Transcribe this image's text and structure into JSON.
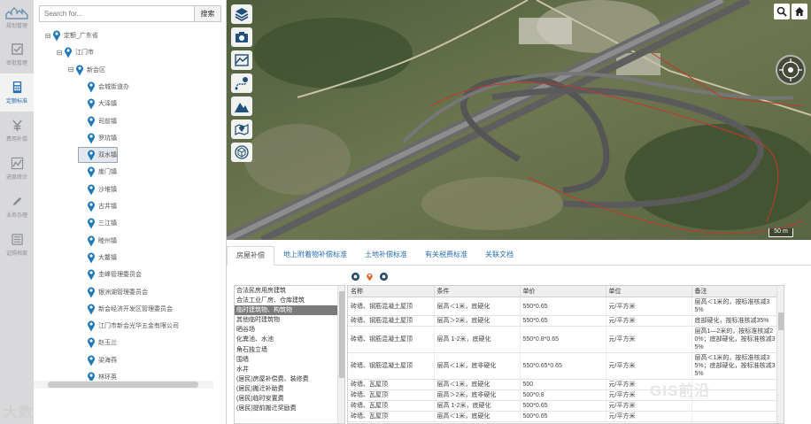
{
  "nav": {
    "logo_label": "",
    "items": [
      {
        "label": "规划管理",
        "icon": "building-icon"
      },
      {
        "label": "审批管理",
        "icon": "check-square-icon"
      },
      {
        "label": "定额标准",
        "icon": "calculator-icon"
      },
      {
        "label": "费用补偿",
        "icon": "yen-icon"
      },
      {
        "label": "进度统计",
        "icon": "line-chart-icon"
      },
      {
        "label": "业务办理",
        "icon": "pencil-icon"
      },
      {
        "label": "证照档案",
        "icon": "list-icon"
      }
    ]
  },
  "tree": {
    "search_placeholder": "Search for...",
    "search_button": "搜索",
    "nodes": [
      {
        "label": "定额_广东省",
        "level": 0,
        "toggle": "⊟"
      },
      {
        "label": "江门市",
        "level": 1,
        "toggle": "⊟"
      },
      {
        "label": "新会区",
        "level": 2,
        "toggle": "⊟"
      },
      {
        "label": "会城街道办",
        "level": 3,
        "toggle": ""
      },
      {
        "label": "大泽镇",
        "level": 3,
        "toggle": ""
      },
      {
        "label": "司前镇",
        "level": 3,
        "toggle": ""
      },
      {
        "label": "罗坑镇",
        "level": 3,
        "toggle": ""
      },
      {
        "label": "双水镇",
        "level": 3,
        "toggle": "",
        "selected": true
      },
      {
        "label": "崖门镇",
        "level": 3,
        "toggle": ""
      },
      {
        "label": "沙堆镇",
        "level": 3,
        "toggle": ""
      },
      {
        "label": "古井镇",
        "level": 3,
        "toggle": ""
      },
      {
        "label": "三江镇",
        "level": 3,
        "toggle": ""
      },
      {
        "label": "睦州镇",
        "level": 3,
        "toggle": ""
      },
      {
        "label": "大鳌镇",
        "level": 3,
        "toggle": ""
      },
      {
        "label": "圭峰管理委员会",
        "level": 3,
        "toggle": ""
      },
      {
        "label": "银洲湖管理委员会",
        "level": 3,
        "toggle": ""
      },
      {
        "label": "新会经济开发区管理委员会",
        "level": 3,
        "toggle": ""
      },
      {
        "label": "江门市新会光华五金有限公司",
        "level": 3,
        "toggle": ""
      },
      {
        "label": "赵玉兰",
        "level": 3,
        "toggle": ""
      },
      {
        "label": "梁海燕",
        "level": 3,
        "toggle": ""
      },
      {
        "label": "林环英",
        "level": 3,
        "toggle": ""
      }
    ]
  },
  "watermark_left": "大数跨境",
  "watermark_right": "GIS前沿",
  "map": {
    "scale_label": "50 m",
    "tools": [
      "layers-icon",
      "camera-icon",
      "terrain-measure-icon",
      "route-pin-icon",
      "mountain-icon",
      "map-pin-icon",
      "cube-icon"
    ]
  },
  "tabs": [
    "房屋补偿",
    "地上附着物补偿标准",
    "土地补偿标准",
    "有关税费标准",
    "关联文档"
  ],
  "active_tab": 0,
  "categories": [
    "合法民房用房建筑",
    "合法工业厂房、仓库建筑",
    "临时建筑物、构筑物",
    "其他临时建筑物",
    "晒谷场",
    "化粪池、水池",
    "角石独立墙",
    "围墙",
    "水井",
    "(居民)房屋补偿费、装修费",
    "(居民)搬迁补助费",
    "(居民)临时安置费",
    "(居民)提前搬迁奖励费"
  ],
  "selected_category": 2,
  "table": {
    "headers": [
      "名称",
      "条件",
      "单价",
      "单位",
      "备注"
    ],
    "rows": [
      [
        "砖墙、钢筋混凝土屋顶",
        "层高＜1米，底硬化",
        "550*0.65",
        "元/平方米",
        "层高＜1米的，按标准核减35%"
      ],
      [
        "砖墙、钢筋混凝土屋顶",
        "层高＞2米，底硬化",
        "550*0.65",
        "元/平方米",
        "底部硬化，按标准核减35%"
      ],
      [
        "砖墙、钢筋混凝土屋顶",
        "层高 1-2米，底硬化",
        "550*0.8*0.65",
        "元/平方米",
        "层高1—2米的，按标准核减20%；底部硬化，按标准核减35%"
      ],
      [
        "砖墙、钢筋混凝土屋顶",
        "层高＜1米，底非硬化",
        "550*0.65*0.65",
        "元/平方米",
        "层高＜1米的，按标准核减35%；底部硬化，按标准核减35%"
      ],
      [
        "砖墙、瓦屋顶",
        "层高＜1米，底硬化",
        "500",
        "元/平方米",
        ""
      ],
      [
        "砖墙、瓦屋顶",
        "层高＞2米，底非硬化",
        "500*0.8",
        "元/平方米",
        ""
      ],
      [
        "砖墙、瓦屋顶",
        "层高 1-2米，底硬化",
        "500*0.65",
        "元/平方米",
        ""
      ],
      [
        "砖墙、瓦屋顶",
        "层高＜1米，底硬化",
        "500*0.65",
        "元/平方米",
        ""
      ]
    ]
  },
  "colors": {
    "accent": "#2a6fb0",
    "nav_bg": "#d9d9db",
    "selected_row": "#7a7a7a",
    "pin": "#1f79b8"
  }
}
